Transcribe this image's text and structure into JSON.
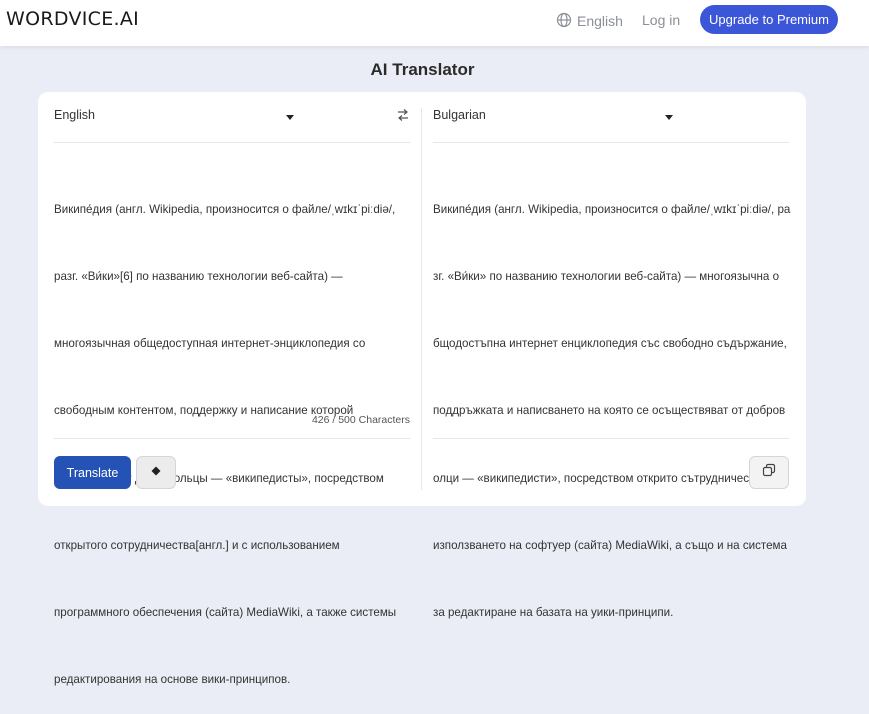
{
  "header": {
    "logo": "WORDVICE.AI",
    "language_link": "English",
    "language_icon": "globe-icon",
    "login": "Log in",
    "premium_button": "Upgrade to Premium",
    "accent_color": "#3c56d8"
  },
  "page": {
    "title": "AI Translator"
  },
  "source": {
    "language": "English",
    "text_lines": [
      "Википе́дия (англ. Wikipedia, произносится о файле/ˌwɪkɪˈpiːdiə/,",
      "разг. «Ви́ки»[6] по названию технологии веб-сайта) —",
      "многоязычная общедоступная интернет-энциклопедия со",
      "свободным контентом, поддержку и написание которой",
      "осуществляют добровольцы — «википедисты», посредством",
      "открытого сотрудничества[англ.] и с использованием",
      "программного обеспечения (сайта) MediaWiki, а также системы",
      "редактирования на основе вики-принципов."
    ],
    "character_count": "426 / 500 Characters",
    "translate_button": "Translate",
    "translate_color": "#2453b5",
    "erase_icon": "eraser-icon",
    "swap_icon": "swap-icon"
  },
  "target": {
    "language": "Bulgarian",
    "text_lines": [
      "Википе́дия (англ. Wikipedia, произносится о файле/ˌwɪkɪˈpiːdiə/, ра",
      "зг. «Ви́ки» по названию технологии веб-сайта) — многоязычна о",
      "бщодостъпна интернет енциклопедия със свободно съдържание,",
      "поддръжката и написването на която се осъществяват от добров",
      "олци — «википедисти», посредством открито сътрудничество и с",
      "използването на софтуер (сайта) MediaWiki, а също и на система",
      "за редактиране на базата на уики-принципи."
    ],
    "copy_icon": "copy-icon"
  }
}
